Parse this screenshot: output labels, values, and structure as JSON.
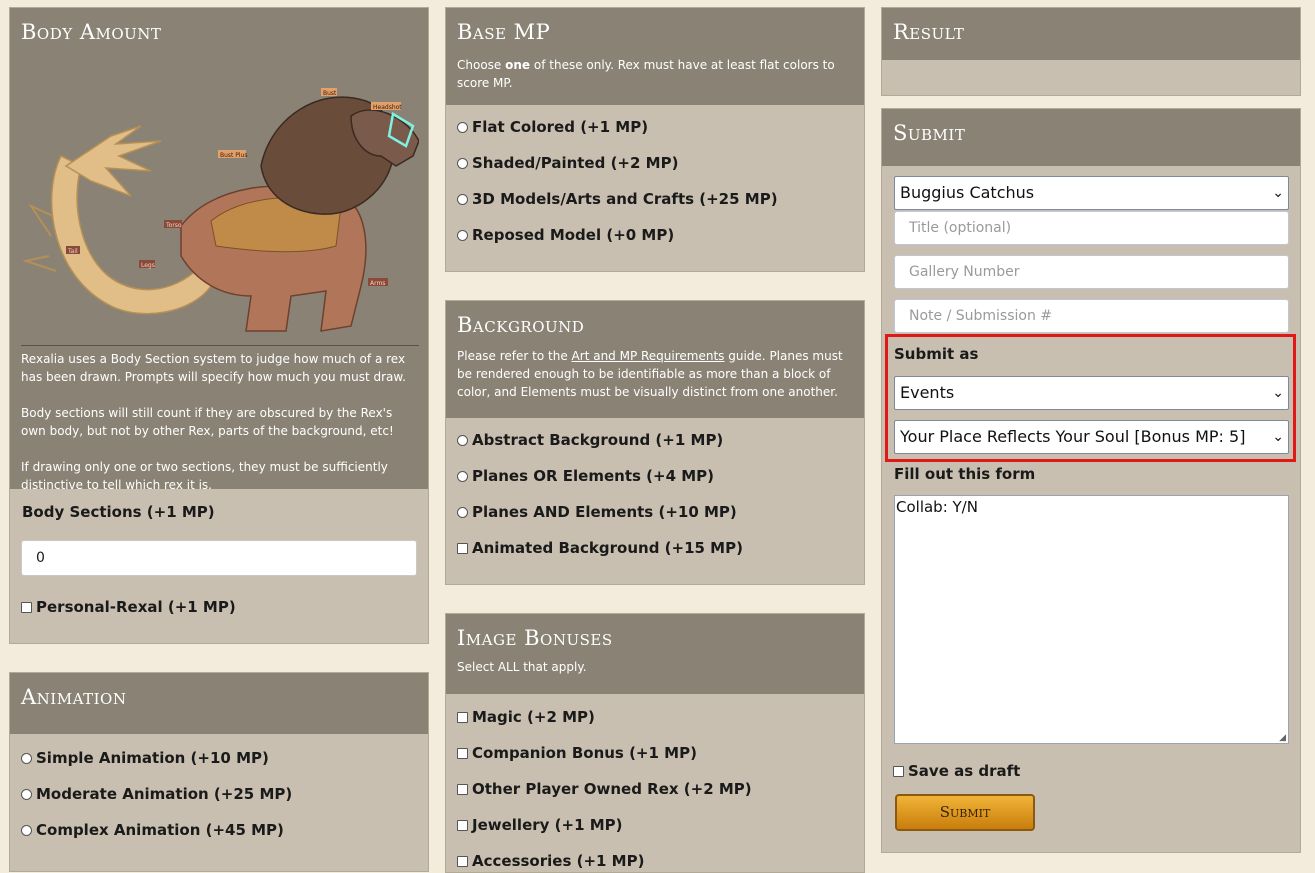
{
  "body_amount": {
    "title": "Body Amount",
    "image_labels": {
      "bust": "Bust",
      "headshot": "Headshot",
      "bust_plus": "Bust Plus",
      "torso": "Torso",
      "tail": "Tail",
      "legs": "Legs",
      "arms": "Arms"
    },
    "desc1": "Rexalia uses a Body Section system to judge how much of a rex has been drawn. Prompts will specify how much you must draw.",
    "desc2": "Body sections will still count if they are obscured by the Rex's own body, but not by other Rex, parts of the background, etc!",
    "desc3": "If drawing only one or two sections, they must be sufficiently distinctive to tell which rex it is.",
    "sections_label": "Body Sections (+1 MP)",
    "sections_value": "0",
    "personal_rexal": "Personal-Rexal (+1 MP)"
  },
  "animation": {
    "title": "Animation",
    "options": [
      "Simple Animation (+10 MP)",
      "Moderate Animation (+25 MP)",
      "Complex Animation (+45 MP)"
    ]
  },
  "base_mp": {
    "title": "Base MP",
    "desc_pre": "Choose ",
    "desc_bold": "one",
    "desc_post": " of these only. Rex must have at least flat colors to score MP.",
    "options": [
      "Flat Colored (+1 MP)",
      "Shaded/Painted (+2 MP)",
      "3D Models/Arts and Crafts (+25 MP)",
      "Reposed Model (+0 MP)"
    ]
  },
  "background": {
    "title": "Background",
    "desc_pre": "Please refer to the ",
    "desc_link": "Art and MP Requirements",
    "desc_post": " guide. Planes must be rendered enough to be identifiable as more than a block of color, and Elements must be visually distinct from one another.",
    "options": [
      "Abstract Background (+1 MP)",
      "Planes OR Elements (+4 MP)",
      "Planes AND Elements (+10 MP)"
    ],
    "animated": "Animated Background (+15 MP)"
  },
  "image_bonuses": {
    "title": "Image Bonuses",
    "desc": "Select ALL that apply.",
    "options": [
      "Magic (+2 MP)",
      "Companion Bonus (+1 MP)",
      "Other Player Owned Rex (+2 MP)",
      "Jewellery (+1 MP)",
      "Accessories (+1 MP)"
    ]
  },
  "result": {
    "title": "Result"
  },
  "submit": {
    "title": "Submit",
    "character_select": "Buggius Catchus",
    "title_placeholder": "Title (optional)",
    "gallery_placeholder": "Gallery Number",
    "note_placeholder": "Note / Submission #",
    "submit_as_label": "Submit as",
    "submit_as_value": "Events",
    "event_value": "Your Place Reflects Your Soul [Bonus MP: 5]",
    "form_label": "Fill out this form",
    "form_text": "Collab: Y/N",
    "save_draft": "Save as draft",
    "submit_button": "Submit"
  },
  "colors": {
    "header": "#8a8375",
    "panel": "#c8bfb0",
    "highlight": "#e01818",
    "button": "#d98e0f"
  }
}
